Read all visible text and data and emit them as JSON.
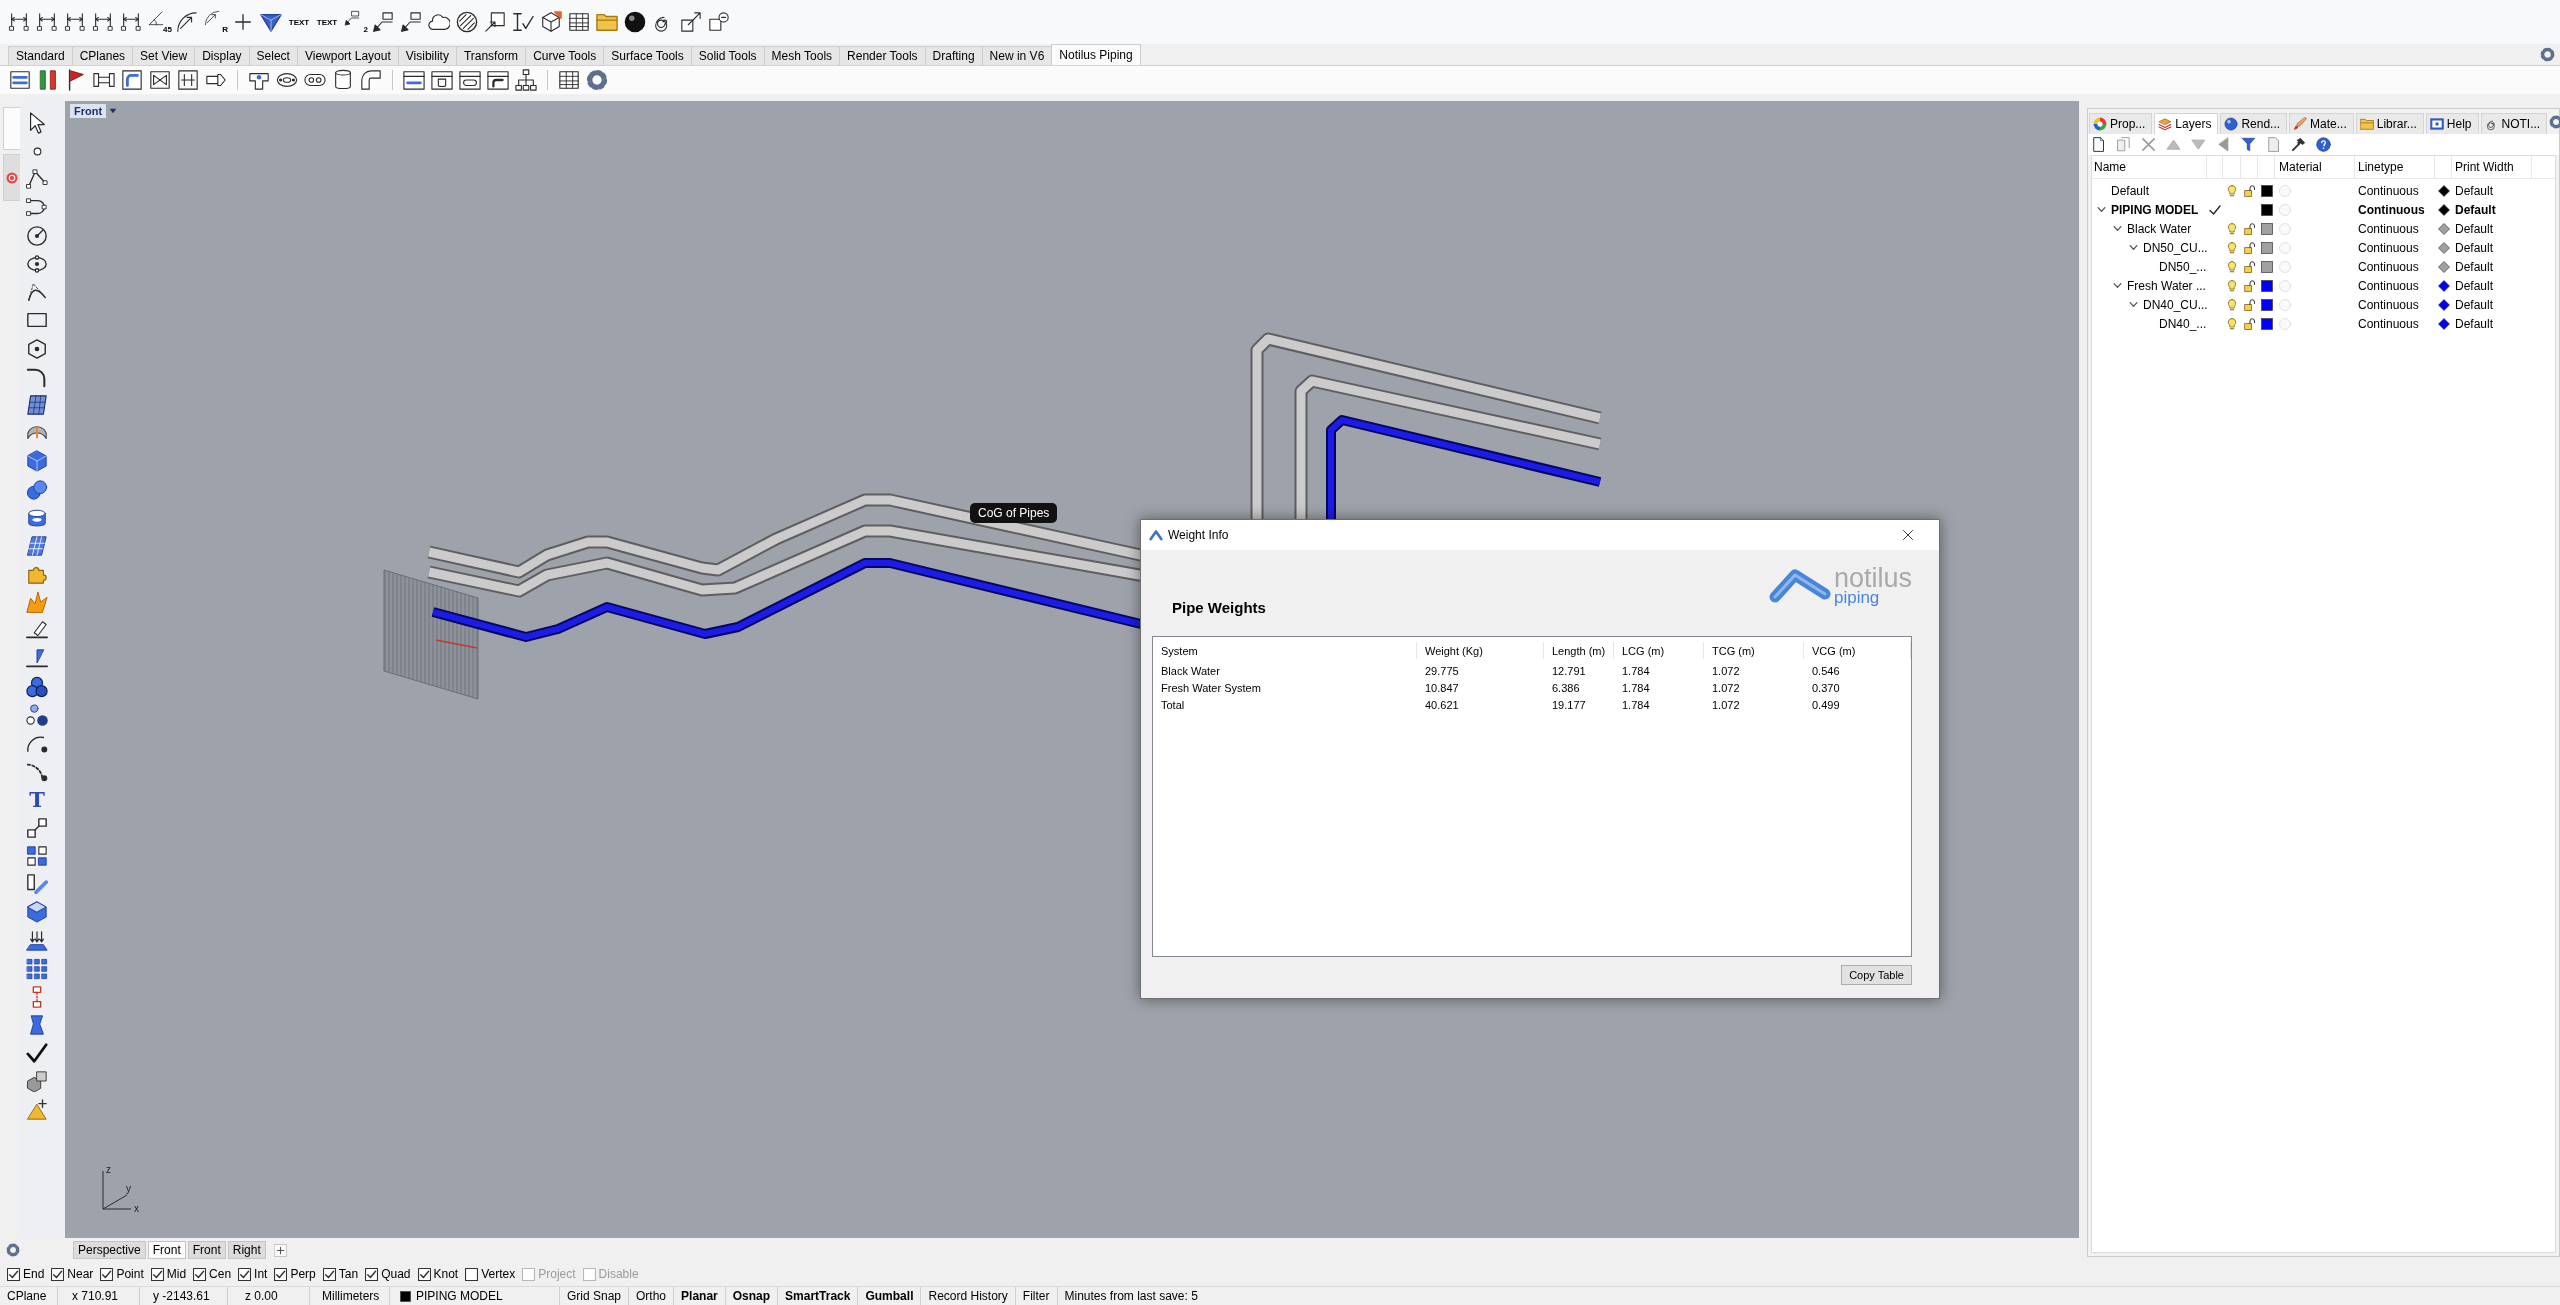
{
  "main_toolbar": [
    {
      "kind": "tool"
    },
    {
      "kind": "tool"
    },
    {
      "kind": "tool"
    },
    {
      "kind": "tool"
    },
    {
      "kind": "tool"
    },
    {
      "kind": "captioned",
      "label": "45"
    },
    {
      "kind": "tool"
    },
    {
      "kind": "captioned",
      "label": "R"
    },
    {
      "kind": "tool"
    },
    {
      "kind": "tool"
    },
    {
      "kind": "text",
      "label": "TEXT"
    },
    {
      "kind": "text",
      "label": "TEXT"
    },
    {
      "kind": "captioned",
      "label": "2"
    },
    {
      "kind": "tool"
    },
    {
      "kind": "tool"
    },
    {
      "kind": "tool"
    },
    {
      "kind": "tool"
    },
    {
      "kind": "tool"
    },
    {
      "kind": "tool"
    },
    {
      "kind": "tool"
    },
    {
      "kind": "tool"
    },
    {
      "kind": "tool"
    },
    {
      "kind": "tool"
    },
    {
      "kind": "tool"
    },
    {
      "kind": "tool"
    },
    {
      "kind": "tool"
    }
  ],
  "command_tabs": [
    {
      "label": "Standard",
      "selected": false
    },
    {
      "label": "CPlanes",
      "selected": false
    },
    {
      "label": "Set View",
      "selected": false
    },
    {
      "label": "Display",
      "selected": false
    },
    {
      "label": "Select",
      "selected": false
    },
    {
      "label": "Viewport Layout",
      "selected": false
    },
    {
      "label": "Visibility",
      "selected": false
    },
    {
      "label": "Transform",
      "selected": false
    },
    {
      "label": "Curve Tools",
      "selected": false
    },
    {
      "label": "Surface Tools",
      "selected": false
    },
    {
      "label": "Solid Tools",
      "selected": false
    },
    {
      "label": "Mesh Tools",
      "selected": false
    },
    {
      "label": "Render Tools",
      "selected": false
    },
    {
      "label": "Drafting",
      "selected": false
    },
    {
      "label": "New in V6",
      "selected": false
    },
    {
      "label": "Notilus Piping",
      "selected": true
    }
  ],
  "secondary_toolbar": [
    {
      "kind": "tool"
    },
    {
      "kind": "tool"
    },
    {
      "kind": "tool"
    },
    {
      "kind": "tool"
    },
    {
      "kind": "tool"
    },
    {
      "kind": "tool"
    },
    {
      "kind": "tool"
    },
    {
      "kind": "tool"
    },
    {
      "kind": "separator"
    },
    {
      "kind": "tool"
    },
    {
      "kind": "tool"
    },
    {
      "kind": "tool"
    },
    {
      "kind": "tool"
    },
    {
      "kind": "tool"
    },
    {
      "kind": "separator"
    },
    {
      "kind": "tool"
    },
    {
      "kind": "tool"
    },
    {
      "kind": "tool"
    },
    {
      "kind": "tool"
    },
    {
      "kind": "tool"
    },
    {
      "kind": "separator"
    },
    {
      "kind": "tool"
    },
    {
      "kind": "tool"
    }
  ],
  "left_toolbar": [
    {
      "kind": "tool"
    },
    {
      "kind": "tool"
    },
    {
      "kind": "tool"
    },
    {
      "kind": "tool"
    },
    {
      "kind": "tool"
    },
    {
      "kind": "tool"
    },
    {
      "kind": "tool"
    },
    {
      "kind": "tool"
    },
    {
      "kind": "tool"
    },
    {
      "kind": "tool"
    },
    {
      "kind": "tool"
    },
    {
      "kind": "tool"
    },
    {
      "kind": "tool"
    },
    {
      "kind": "tool"
    },
    {
      "kind": "tool"
    },
    {
      "kind": "tool"
    },
    {
      "kind": "tool"
    },
    {
      "kind": "tool"
    },
    {
      "kind": "tool"
    },
    {
      "kind": "tool"
    },
    {
      "kind": "tool"
    },
    {
      "kind": "tool"
    },
    {
      "kind": "tool"
    },
    {
      "kind": "tool"
    },
    {
      "kind": "text",
      "label": "T"
    },
    {
      "kind": "tool"
    },
    {
      "kind": "tool"
    },
    {
      "kind": "tool"
    },
    {
      "kind": "tool"
    },
    {
      "kind": "tool"
    },
    {
      "kind": "tool"
    },
    {
      "kind": "tool"
    },
    {
      "kind": "tool"
    },
    {
      "kind": "tool"
    },
    {
      "kind": "tool"
    },
    {
      "kind": "tool"
    }
  ],
  "viewport": {
    "title": "Front",
    "tag": "CoG of Pipes",
    "axes": [
      "z",
      "y",
      "x"
    ]
  },
  "weight_dialog": {
    "title": "Weight Info",
    "logo": {
      "name": "notilus",
      "subtitle": "piping"
    },
    "heading": "Pipe Weights",
    "table": {
      "columns": [
        "System",
        "Weight (Kg)",
        "Length (m)",
        "LCG (m)",
        "TCG (m)",
        "VCG (m)"
      ],
      "rows": [
        [
          "Black Water",
          "29.775",
          "12.791",
          "1.784",
          "1.072",
          "0.546"
        ],
        [
          "Fresh Water System",
          "10.847",
          "6.386",
          "1.784",
          "1.072",
          "0.370"
        ],
        [
          "Total",
          "40.621",
          "19.177",
          "1.784",
          "1.072",
          "0.499"
        ]
      ]
    },
    "buttons": [
      "Copy Table"
    ]
  },
  "viewport_tabs": [
    {
      "label": "Perspective",
      "selected": false
    },
    {
      "label": "Front",
      "selected": true
    },
    {
      "label": "Front",
      "selected": false
    },
    {
      "label": "Right",
      "selected": false
    }
  ],
  "side_panel": {
    "tabs": [
      {
        "label": "Prop...",
        "selected": false
      },
      {
        "label": "Layers",
        "selected": true
      },
      {
        "label": "Rend...",
        "selected": false
      },
      {
        "label": "Mate...",
        "selected": false
      },
      {
        "label": "Librar...",
        "selected": false
      },
      {
        "label": "Help",
        "selected": false
      },
      {
        "label": "NOTI...",
        "selected": false
      }
    ],
    "layers": {
      "columns": [
        "Name",
        "Material",
        "Linetype",
        "Print Width"
      ],
      "rows": [
        {
          "name": "Default",
          "color": "#000000",
          "current": false,
          "visible": true,
          "locked": false,
          "expanded": false,
          "linetype": "Continuous",
          "print_width": "Default"
        },
        {
          "name": "PIPING MODEL",
          "color": "#000000",
          "current": true,
          "visible": true,
          "locked": false,
          "expanded": true,
          "linetype": "Continuous",
          "print_width": "Default",
          "children": [
            {
              "name": "Black Water",
              "color": "#a0a0a0",
              "current": false,
              "visible": true,
              "locked": false,
              "expanded": true,
              "linetype": "Continuous",
              "print_width": "Default",
              "children": [
                {
                  "name": "DN50_CU...",
                  "color": "#a0a0a0",
                  "current": false,
                  "visible": true,
                  "locked": false,
                  "expanded": true,
                  "linetype": "Continuous",
                  "print_width": "Default",
                  "children": [
                    {
                      "name": "DN50_...",
                      "color": "#a0a0a0",
                      "current": false,
                      "visible": true,
                      "locked": false,
                      "expanded": false,
                      "linetype": "Continuous",
                      "print_width": "Default"
                    }
                  ]
                }
              ]
            },
            {
              "name": "Fresh Water ...",
              "color": "#0000ff",
              "current": false,
              "visible": true,
              "locked": false,
              "expanded": true,
              "linetype": "Continuous",
              "print_width": "Default",
              "children": [
                {
                  "name": "DN40_CU...",
                  "color": "#0000ff",
                  "current": false,
                  "visible": true,
                  "locked": false,
                  "expanded": true,
                  "linetype": "Continuous",
                  "print_width": "Default",
                  "children": [
                    {
                      "name": "DN40_...",
                      "color": "#0000ff",
                      "current": false,
                      "visible": true,
                      "locked": false,
                      "expanded": false,
                      "linetype": "Continuous",
                      "print_width": "Default"
                    }
                  ]
                }
              ]
            }
          ]
        }
      ]
    }
  },
  "osnaps": [
    {
      "label": "End",
      "checked": true,
      "disabled": false
    },
    {
      "label": "Near",
      "checked": true,
      "disabled": false
    },
    {
      "label": "Point",
      "checked": true,
      "disabled": false
    },
    {
      "label": "Mid",
      "checked": true,
      "disabled": false
    },
    {
      "label": "Cen",
      "checked": true,
      "disabled": false
    },
    {
      "label": "Int",
      "checked": true,
      "disabled": false
    },
    {
      "label": "Perp",
      "checked": true,
      "disabled": false
    },
    {
      "label": "Tan",
      "checked": true,
      "disabled": false
    },
    {
      "label": "Quad",
      "checked": true,
      "disabled": false
    },
    {
      "label": "Knot",
      "checked": true,
      "disabled": false
    },
    {
      "label": "Vertex",
      "checked": false,
      "disabled": false
    },
    {
      "label": "Project",
      "checked": false,
      "disabled": true
    },
    {
      "label": "Disable",
      "checked": false,
      "disabled": true
    }
  ],
  "status_bar": {
    "cplane": "CPlane",
    "x": "x 710.91",
    "y": "y -2143.61",
    "z": "z 0.00",
    "units": "Millimeters",
    "layer": {
      "name": "PIPING MODEL",
      "color": "#000000"
    },
    "toggles": [
      {
        "label": "Grid Snap",
        "on": false
      },
      {
        "label": "Ortho",
        "on": false
      },
      {
        "label": "Planar",
        "on": true
      },
      {
        "label": "Osnap",
        "on": true
      },
      {
        "label": "SmartTrack",
        "on": true
      },
      {
        "label": "Gumball",
        "on": true
      },
      {
        "label": "Record History",
        "on": false
      },
      {
        "label": "Filter",
        "on": false
      }
    ],
    "save_info": "Minutes from last save: 5"
  }
}
